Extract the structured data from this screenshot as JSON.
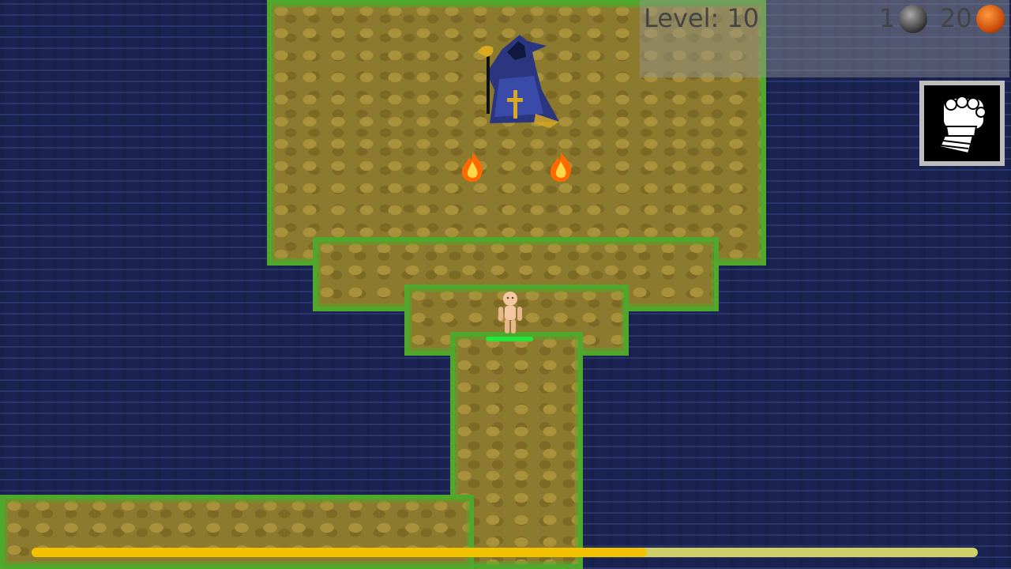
{
  "hud": {
    "level_label": "Level: 10",
    "gray_orbs_count": "1",
    "orange_orbs_count": "20"
  },
  "icons": {
    "gray_orb": "gray-orb-icon",
    "orange_orb": "orange-orb-icon",
    "fist": "fist-icon"
  },
  "progress": {
    "value": 0.65
  },
  "colors": {
    "progress_fill": "#f2c200",
    "progress_track": "#cfcf6a",
    "health": "#27e53a"
  }
}
